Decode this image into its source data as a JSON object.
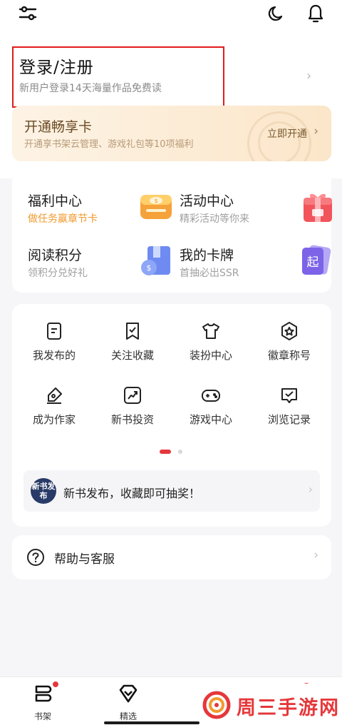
{
  "login": {
    "title": "登录/注册",
    "subtitle": "新用户登录14天海量作品免费读"
  },
  "vip": {
    "title": "开通畅享卡",
    "subtitle": "开通享书架云管理、游戏礼包等10项福利",
    "open_label": "立即开通",
    "chevron": "›"
  },
  "benefits": [
    {
      "title": "福利中心",
      "subtitle": "做任务赢章节卡",
      "icon": "wallet-icon"
    },
    {
      "title": "活动中心",
      "subtitle": "精彩活动等你来",
      "icon": "gift-icon"
    },
    {
      "title": "阅读积分",
      "subtitle": "领积分兑好礼",
      "icon": "points-book-icon"
    },
    {
      "title": "我的卡牌",
      "subtitle": "首抽必出SSR",
      "icon": "card-icon"
    }
  ],
  "grid": [
    {
      "label": "我发布的",
      "icon": "document-icon"
    },
    {
      "label": "关注收藏",
      "icon": "bookmark-check-icon"
    },
    {
      "label": "装扮中心",
      "icon": "tshirt-icon"
    },
    {
      "label": "徽章称号",
      "icon": "badge-star-icon"
    },
    {
      "label": "成为作家",
      "icon": "pen-icon"
    },
    {
      "label": "新书投资",
      "icon": "chart-icon"
    },
    {
      "label": "游戏中心",
      "icon": "gamepad-icon"
    },
    {
      "label": "浏览记录",
      "icon": "history-icon"
    }
  ],
  "pager": {
    "current": 1,
    "total": 2
  },
  "promo": {
    "badge": "新书发布",
    "text": "新书发布，收藏即可抽奖！"
  },
  "help": {
    "label": "帮助与客服"
  },
  "bottom_nav": [
    {
      "label": "书架",
      "icon": "bookshelf-icon",
      "badge": true
    },
    {
      "label": "精选",
      "icon": "diamond-icon",
      "badge": false
    }
  ],
  "watermark": {
    "text": "周三手游网"
  },
  "colors": {
    "accent": "#e5383b",
    "highlight_border": "#e11b1b",
    "vip_gold": "#6b4a24",
    "benefit_orange": "#f29a2e"
  }
}
